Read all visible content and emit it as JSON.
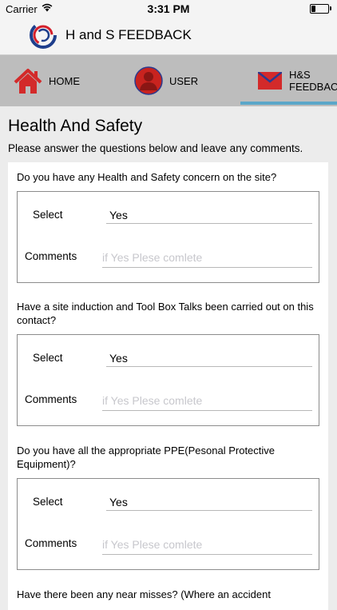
{
  "status_bar": {
    "carrier": "Carrier",
    "time": "3:31 PM",
    "battery_level": 0.25
  },
  "header": {
    "title": "H and S FEEDBACK"
  },
  "tabs": [
    {
      "label": "HOME",
      "icon": "home-icon"
    },
    {
      "label": "USER",
      "icon": "user-icon"
    },
    {
      "label": "H&S",
      "label_line2": "FEEDBACK",
      "icon": "mail-icon",
      "selected": true
    }
  ],
  "page": {
    "title": "Health And Safety",
    "subtitle": "Please answer the questions below and leave any comments."
  },
  "labels": {
    "select": "Select",
    "comments": "Comments"
  },
  "questions": [
    {
      "text": "Do you have any Health and Safety concern on the site?",
      "select_value": "Yes",
      "comment_placeholder": "if Yes Plese comlete",
      "comment_value": ""
    },
    {
      "text": "Have a site induction and Tool Box Talks been carried out on this contact?",
      "select_value": "Yes",
      "comment_placeholder": "if Yes Plese comlete",
      "comment_value": ""
    },
    {
      "text": "Do you have all the appropriate PPE(Pesonal Protective Equipment)?",
      "select_value": "Yes",
      "comment_placeholder": "if Yes Plese comlete",
      "comment_value": ""
    },
    {
      "text": "Have there been any near misses? (Where an accident"
    }
  ],
  "colors": {
    "tab_bar": "#bdbdbd",
    "tab_indicator": "#5ba7c9",
    "home_icon": "#d32a2a",
    "user_icon": "#c8231f",
    "mail_icon": "#d32a2a",
    "logo_blue": "#1e3e8c",
    "logo_red": "#d4202c"
  }
}
